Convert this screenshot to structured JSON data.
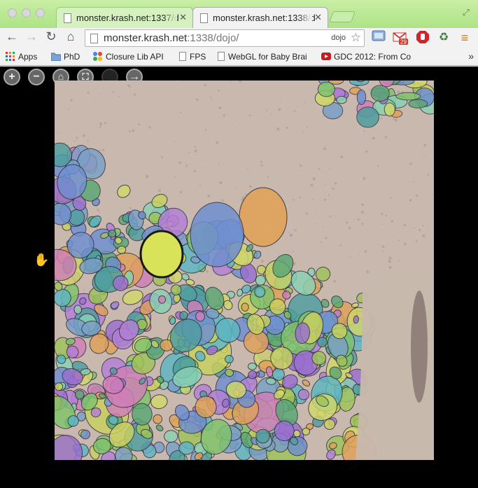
{
  "browser": {
    "tabs": [
      {
        "label": "monster.krash.net:1337/d",
        "active": false
      },
      {
        "label": "monster.krash.net:1338/d",
        "active": true
      }
    ],
    "url_host": "monster.krash.net",
    "url_path": ":1338/dojo/",
    "omnibox_ext": "dojo",
    "gmail_badge": "29",
    "bookmarks": [
      {
        "label": "Apps",
        "icon": "apps-grid-icon"
      },
      {
        "label": "PhD",
        "icon": "folder-icon"
      },
      {
        "label": "Closure Lib API",
        "icon": "closure-icon"
      },
      {
        "label": "FPS",
        "icon": "page-icon"
      },
      {
        "label": "WebGL for Baby Brai",
        "icon": "page-icon"
      },
      {
        "label": "GDC 2012: From Co",
        "icon": "youtube-icon"
      }
    ],
    "more_bookmarks": "»"
  },
  "viewer": {
    "zoom_in": "+",
    "zoom_out": "−",
    "home": "⌂",
    "fullscreen": "⛶",
    "next": "→"
  },
  "colors": {
    "titlebar": "#b2e58a",
    "membrane": "#c8b8ad",
    "segment_palette": [
      "#6f8fd0",
      "#7fc46a",
      "#b47fd6",
      "#e0a25a",
      "#5cb6c4",
      "#d1d86a",
      "#9a6fd0",
      "#5aa874",
      "#7aa0c8",
      "#c9d15f",
      "#8ad1b4",
      "#d07fb8",
      "#4f9f9f",
      "#a0c45a"
    ]
  }
}
